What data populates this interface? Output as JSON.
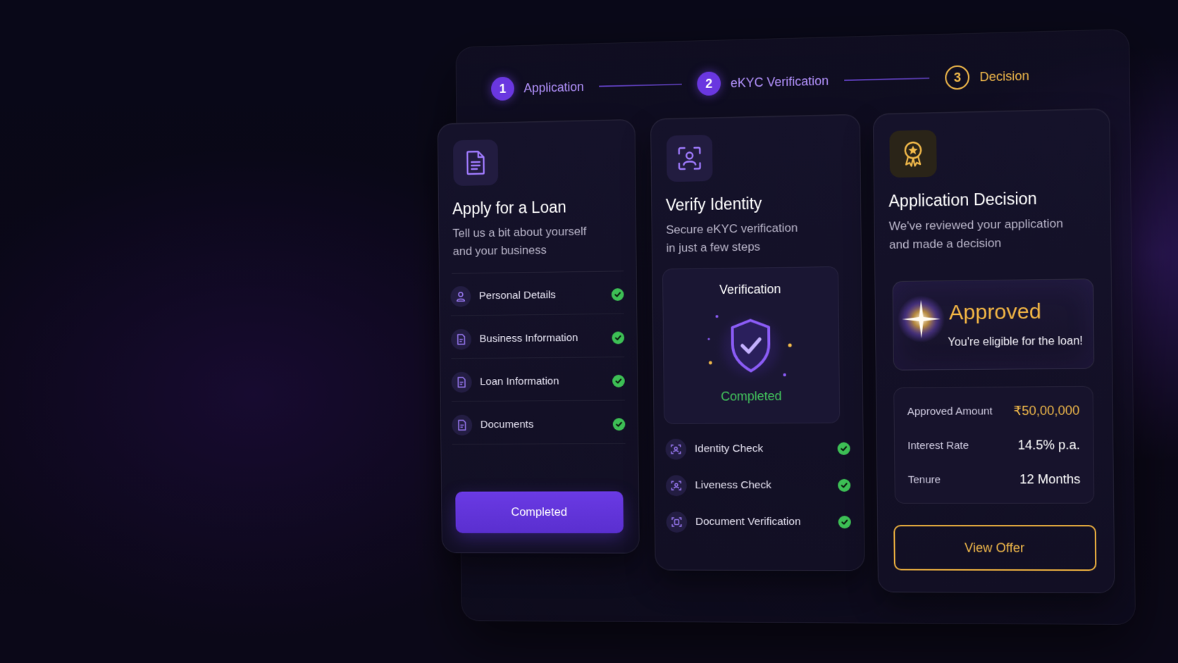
{
  "stepper": {
    "steps": [
      {
        "number": "1",
        "label": "Application"
      },
      {
        "number": "2",
        "label": "eKYC Verification"
      },
      {
        "number": "3",
        "label": "Decision"
      }
    ]
  },
  "apply_card": {
    "icon": "document-icon",
    "title": "Apply for a Loan",
    "subtitle": "Tell us a bit about yourself and your business",
    "items": [
      {
        "label": "Personal Details",
        "icon": "user-icon",
        "status": "complete"
      },
      {
        "label": "Business Information",
        "icon": "file-icon",
        "status": "complete"
      },
      {
        "label": "Loan Information",
        "icon": "file-icon",
        "status": "complete"
      },
      {
        "label": "Documents",
        "icon": "file-icon",
        "status": "complete"
      }
    ],
    "button_label": "Completed"
  },
  "verify_card": {
    "icon": "face-scan-icon",
    "title": "Verify Identity",
    "subtitle": "Secure eKYC verification in just a few steps",
    "verification": {
      "title": "Verification",
      "status": "Completed"
    },
    "items": [
      {
        "label": "Identity Check",
        "icon": "face-id-icon",
        "status": "complete"
      },
      {
        "label": "Liveness Check",
        "icon": "face-id-icon",
        "status": "complete"
      },
      {
        "label": "Document Verification",
        "icon": "doc-scan-icon",
        "status": "complete"
      }
    ]
  },
  "decision_card": {
    "icon": "award-badge-icon",
    "title": "Application Decision",
    "subtitle": "We've reviewed your application and made a decision",
    "result": {
      "status": "Approved",
      "message": "You're eligible for the loan!"
    },
    "details": [
      {
        "label": "Approved Amount",
        "value": "₹50,00,000"
      },
      {
        "label": "Interest Rate",
        "value": "14.5% p.a."
      },
      {
        "label": "Tenure",
        "value": "12 Months"
      }
    ],
    "button_label": "View Offer"
  },
  "colors": {
    "accent_purple": "#6a37e0",
    "accent_gold": "#f1b94a",
    "success_green": "#3dbf55",
    "background": "#07061a"
  }
}
